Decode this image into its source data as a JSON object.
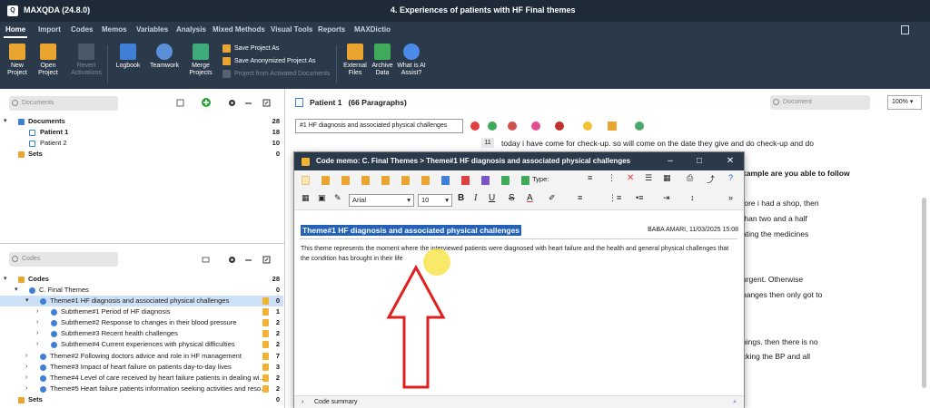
{
  "app": {
    "name": "MAXQDA (24.8.0)",
    "window_title": "4. Experiences of patients with HF Final themes"
  },
  "menu": [
    "Home",
    "Import",
    "Codes",
    "Memos",
    "Variables",
    "Analysis",
    "Mixed Methods",
    "Visual Tools",
    "Reports",
    "MAXDictio"
  ],
  "ribbon": {
    "new_project": "New Project",
    "open_project": "Open Project",
    "revert_activations": "Revert Activations",
    "logbook": "Logbook",
    "teamwork": "Teamwork",
    "merge_projects": "Merge Projects",
    "save_project_as": "Save Project As",
    "save_anonymized": "Save Anonymized Project As",
    "project_from_activated": "Project from Activated Documents",
    "external_files": "External Files",
    "archive_data": "Archive Data",
    "ai_assist": "What is AI Assist?"
  },
  "documents": {
    "search_placeholder": "Documents",
    "root": {
      "label": "Documents",
      "count": "28"
    },
    "items": [
      {
        "label": "Patient 1",
        "count": "18"
      },
      {
        "label": "Patient 2",
        "count": "10"
      }
    ],
    "sets": {
      "label": "Sets",
      "count": "0"
    }
  },
  "codes": {
    "search_placeholder": "Codes",
    "root": {
      "label": "Codes",
      "count": "28"
    },
    "items": [
      {
        "label": "C. Final Themes",
        "count": "0"
      },
      {
        "label": "Theme#1 HF diagnosis and associated physical challenges",
        "count": "0"
      },
      {
        "label": "Subtheme#1 Period of HF diagnosis",
        "count": "1"
      },
      {
        "label": "Subtheme#2 Response to changes in their blood pressure",
        "count": "2"
      },
      {
        "label": "Subtheme#3 Recent health challenges",
        "count": "2"
      },
      {
        "label": "Subtheme#4 Current experiences with physical difficulties",
        "count": "2"
      },
      {
        "label": "Theme#2 Following doctors advice and role in HF management",
        "count": "7"
      },
      {
        "label": "Theme#3 Impact of heart failure on patients day-to-day lives",
        "count": "3"
      },
      {
        "label": "Theme#4 Level of care received  by heart failure patients in  dealing wi...",
        "count": "2"
      },
      {
        "label": "Theme#5 Heart failure patients information seeking activities and reso...",
        "count": "2"
      }
    ],
    "sets": {
      "label": "Sets",
      "count": "0"
    }
  },
  "document_browser": {
    "title": "Patient 1",
    "paragraphs": "(66 Paragraphs)",
    "search_placeholder": "Document",
    "zoom": "100%",
    "code_select": "#1 HF diagnosis and associated physical challenges",
    "para_number": "11",
    "lines": [
      "today i have come for check-up. so will come on the date they give and do check-up and do",
      "xample are you able to follow",
      "fore i had a shop, then",
      " than two and a half",
      "ating the medicines",
      " urgent. Otherwise",
      "hanges then only got to",
      "hings. then there is no",
      "cking the BP and all"
    ]
  },
  "memo": {
    "title": "Code memo: C. Final Themes > Theme#1 HF diagnosis and associated physical challenges",
    "type_label": "Type:",
    "font": "Arial",
    "font_size": "10",
    "heading": "Theme#1 HF diagnosis and associated physical challenges",
    "author": "BABA  AMARI, 11/03/2025 15:08",
    "body": "This theme represents the moment where the interviewed patients were diagnosed with heart failure and the health and general physical challenges that the condition has brought in their life",
    "footer": "Code summary"
  },
  "colors": {
    "titlebar": "#1e2a38",
    "ribbon": "#2b3a4a",
    "selection": "#2462b7",
    "arrow": "#e02020"
  }
}
